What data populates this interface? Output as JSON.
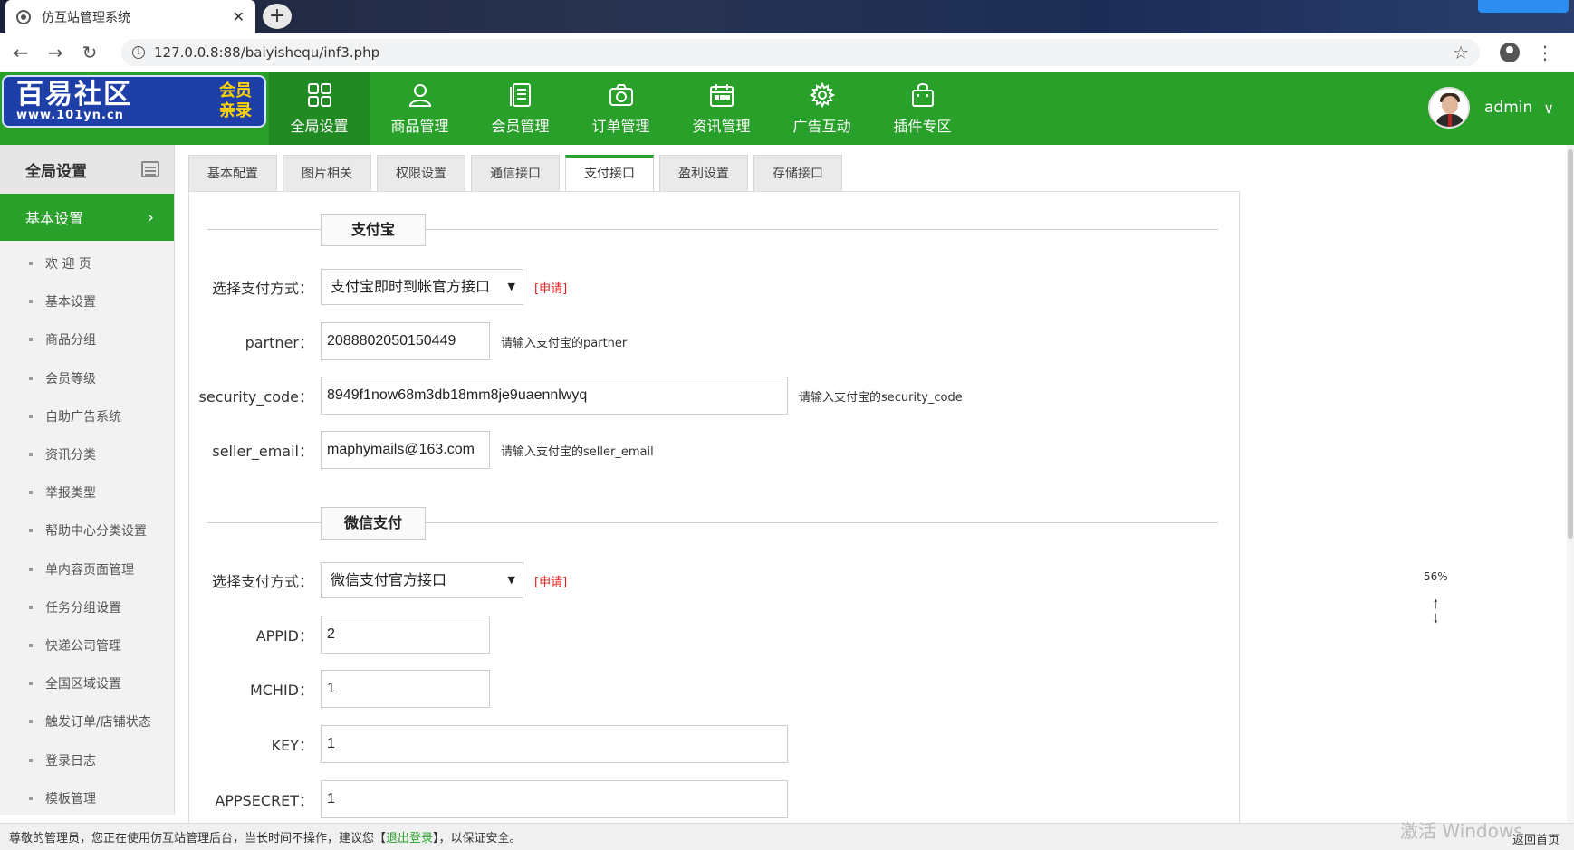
{
  "browser": {
    "tab_title": "仿互站管理系统",
    "url": "127.0.0.8:88/baiyishequ/inf3.php"
  },
  "logo": {
    "main": "百易社区",
    "url": "www.101yn.cn",
    "side_top": "会员",
    "side_bottom": "亲录"
  },
  "nav": {
    "items": [
      {
        "label": "全局设置",
        "icon": "grid-icon"
      },
      {
        "label": "商品管理",
        "icon": "user-icon"
      },
      {
        "label": "会员管理",
        "icon": "list-icon"
      },
      {
        "label": "订单管理",
        "icon": "camera-icon"
      },
      {
        "label": "资讯管理",
        "icon": "calendar-icon"
      },
      {
        "label": "广告互动",
        "icon": "gear-icon"
      },
      {
        "label": "插件专区",
        "icon": "bag-icon"
      }
    ],
    "active_index": 0
  },
  "user": {
    "name": "admin"
  },
  "sidebar": {
    "header": "全局设置",
    "active_group": "基本设置",
    "items": [
      "欢 迎 页",
      "基本设置",
      "商品分组",
      "会员等级",
      "自助广告系统",
      "资讯分类",
      "举报类型",
      "帮助中心分类设置",
      "单内容页面管理",
      "任务分组设置",
      "快递公司管理",
      "全国区域设置",
      "触发订单/店铺状态",
      "登录日志",
      "模板管理"
    ]
  },
  "tabs": [
    "基本配置",
    "图片相关",
    "权限设置",
    "通信接口",
    "支付接口",
    "盈利设置",
    "存储接口"
  ],
  "active_tab": "支付接口",
  "alipay": {
    "section_title": "支付宝",
    "method_label": "选择支付方式：",
    "method_value": "支付宝即时到帐官方接口",
    "apply": "[申请]",
    "partner_label": "partner：",
    "partner_value": "2088802050150449",
    "partner_hint": "请输入支付宝的partner",
    "security_label": "security_code：",
    "security_value": "8949f1now68m3db18mm8je9uaennlwyq",
    "security_hint": "请输入支付宝的security_code",
    "email_label": "seller_email：",
    "email_value": "maphymails@163.com",
    "email_hint": "请输入支付宝的seller_email"
  },
  "wechat": {
    "section_title": "微信支付",
    "method_label": "选择支付方式：",
    "method_value": "微信支付官方接口",
    "apply": "[申请]",
    "appid_label": "APPID：",
    "appid_value": "2",
    "mchid_label": "MCHID：",
    "mchid_value": "1",
    "key_label": "KEY：",
    "key_value": "1",
    "appsecret_label": "APPSECRET：",
    "appsecret_value": "1"
  },
  "float_tools": {
    "zoom": "56%"
  },
  "footer": {
    "text_before": "尊敬的管理员，您正在使用仿互站管理后台，当长时间不操作，建议您【",
    "logout": "退出登录",
    "text_after": "】，以保证安全。",
    "back_home": "返回首页",
    "watermark": "激活 Windows"
  }
}
